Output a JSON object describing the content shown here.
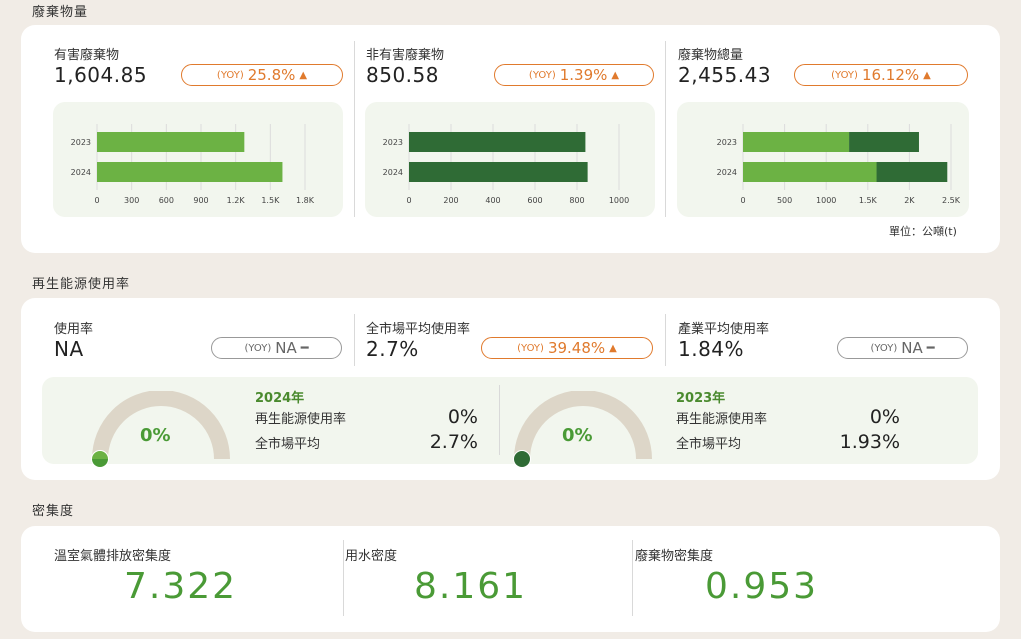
{
  "colors": {
    "accent_orange": "#e07a2d",
    "light_green": "#6cb244",
    "dark_green": "#2f6b35",
    "value_green": "#4a9a36"
  },
  "waste": {
    "section_title": "廢棄物量",
    "metrics": [
      {
        "label": "有害廢棄物",
        "value": "1,604.85",
        "yoy_tag": "(YOY)",
        "yoy_value": "25.8%",
        "trend": "up"
      },
      {
        "label": "非有害廢棄物",
        "value": "850.58",
        "yoy_tag": "(YOY)",
        "yoy_value": "1.39%",
        "trend": "up"
      },
      {
        "label": "廢棄物總量",
        "value": "2,455.43",
        "yoy_tag": "(YOY)",
        "yoy_value": "16.12%",
        "trend": "up"
      }
    ],
    "unit": "單位：公噸(t)"
  },
  "chart_data": [
    {
      "type": "bar",
      "orientation": "horizontal",
      "categories": [
        "2023",
        "2024"
      ],
      "series": [
        {
          "values": [
            1275,
            1604.85
          ]
        }
      ],
      "xlim": [
        0,
        1800
      ],
      "xticks": [
        "0",
        "300",
        "600",
        "900",
        "1.2K",
        "1.5K",
        "1.8K"
      ],
      "grid": true
    },
    {
      "type": "bar",
      "orientation": "horizontal",
      "categories": [
        "2023",
        "2024"
      ],
      "series": [
        {
          "values": [
            840,
            850.58
          ]
        }
      ],
      "xlim": [
        0,
        1000
      ],
      "xticks": [
        "0",
        "200",
        "400",
        "600",
        "800",
        "1000"
      ],
      "grid": true
    },
    {
      "type": "bar",
      "orientation": "horizontal",
      "stacked": true,
      "categories": [
        "2023",
        "2024"
      ],
      "series": [
        {
          "values": [
            1275,
            1604.85
          ]
        },
        {
          "values": [
            840,
            850.58
          ]
        }
      ],
      "xlim": [
        0,
        2500
      ],
      "xticks": [
        "0",
        "500",
        "1000",
        "1.5K",
        "2K",
        "2.5K"
      ],
      "grid": true
    }
  ],
  "renewable": {
    "section_title": "再生能源使用率",
    "metrics": [
      {
        "label": "使用率",
        "value": "NA",
        "yoy_tag": "(YOY)",
        "yoy_value": "NA",
        "trend": "flat"
      },
      {
        "label": "全市場平均使用率",
        "value": "2.7%",
        "yoy_tag": "(YOY)",
        "yoy_value": "39.48%",
        "trend": "up"
      },
      {
        "label": "產業平均使用率",
        "value": "1.84%",
        "yoy_tag": "(YOY)",
        "yoy_value": "NA",
        "trend": "flat"
      }
    ],
    "years": [
      {
        "year": "2024年",
        "gauge_pct": "0%",
        "gauge_value": 0,
        "row1_label": "再生能源使用率",
        "row1_value": "0%",
        "row2_label": "全市場平均",
        "row2_value": "2.7%"
      },
      {
        "year": "2023年",
        "gauge_pct": "0%",
        "gauge_value": 0,
        "row1_label": "再生能源使用率",
        "row1_value": "0%",
        "row2_label": "全市場平均",
        "row2_value": "1.93%"
      }
    ]
  },
  "density": {
    "section_title": "密集度",
    "metrics": [
      {
        "label": "溫室氣體排放密集度",
        "value": "7.322"
      },
      {
        "label": "用水密度",
        "value": "8.161"
      },
      {
        "label": "廢棄物密集度",
        "value": "0.953"
      }
    ]
  }
}
